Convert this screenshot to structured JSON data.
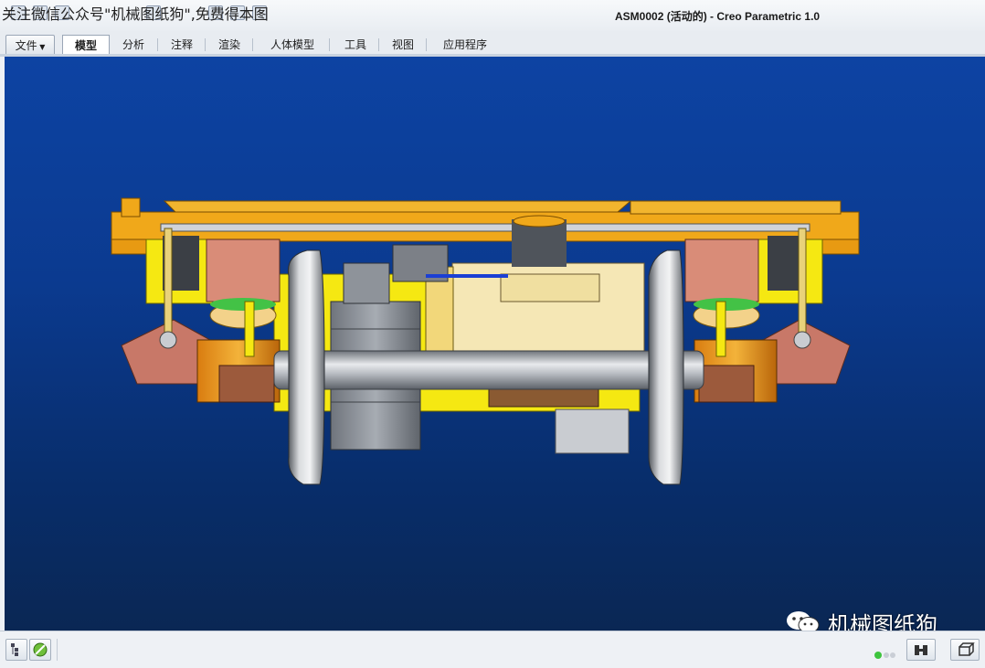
{
  "window": {
    "title": "ASM0002 (活动的) - Creo Parametric 1.0"
  },
  "watermark": {
    "top_text": "关注微信公众号\"机械图纸狗\",免费得本图",
    "bottom_label": "机械图纸狗"
  },
  "ribbon": {
    "file_label": "文件",
    "tabs": [
      {
        "label": "模型",
        "active": true
      },
      {
        "label": "分析"
      },
      {
        "label": "注释"
      },
      {
        "label": "渲染"
      },
      {
        "label": "人体模型"
      },
      {
        "label": "工具"
      },
      {
        "label": "视图"
      },
      {
        "label": "应用程序"
      }
    ]
  },
  "viewport": {
    "background_top": "#0d43a3",
    "background_bottom": "#0a2754",
    "model_colors": {
      "frame": "#f0a81a",
      "yellow": "#f5e812",
      "pink": "#d98c78",
      "brown": "#9c5a3c",
      "steel": "#c9ccd1",
      "grey": "#9aa0a8"
    }
  },
  "statusbar": {
    "icons": [
      "model-tree-icon",
      "layer-icon",
      "status-light-icon",
      "find-icon",
      "3d-box-icon"
    ]
  }
}
